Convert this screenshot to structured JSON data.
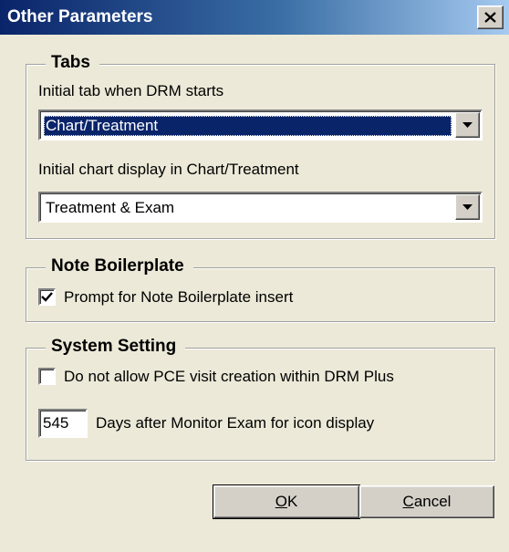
{
  "window": {
    "title": "Other Parameters",
    "close_label": "×"
  },
  "tabs_group": {
    "title": "Tabs",
    "initial_tab_label": "Initial tab when DRM starts",
    "initial_tab_value": "Chart/Treatment",
    "initial_chart_label": "Initial chart display in Chart/Treatment",
    "initial_chart_value": "Treatment & Exam"
  },
  "note_group": {
    "title": "Note Boilerplate",
    "prompt_label": "Prompt for Note Boilerplate insert",
    "prompt_checked": true
  },
  "system_group": {
    "title": "System Setting",
    "pce_label": "Do not allow PCE visit creation within DRM Plus",
    "pce_checked": false,
    "days_value": "545",
    "days_label": "Days after Monitor Exam for icon display"
  },
  "buttons": {
    "ok_accel": "O",
    "ok_rest": "K",
    "cancel_accel": "C",
    "cancel_rest": "ancel"
  },
  "colors": {
    "titlebar_start": "#0a246a",
    "titlebar_end": "#a6caf0",
    "dialog_bg": "#ece9d8",
    "selection": "#0a246a"
  },
  "icons": {
    "close": "close-icon",
    "dropdown": "chevron-down-icon",
    "check": "checkmark-icon"
  }
}
